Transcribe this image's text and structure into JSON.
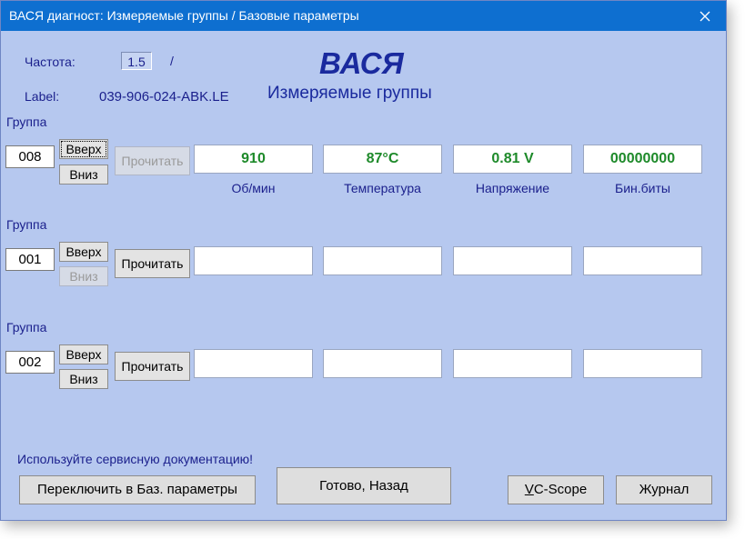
{
  "window": {
    "title": "ВАСЯ диагност: Измеряемые группы / Базовые параметры"
  },
  "header": {
    "freq_label": "Частота:",
    "freq_value": "1.5",
    "freq_suffix": "/",
    "label_label": "Label:",
    "label_value": "039-906-024-ABK.LE",
    "brand": "ВАСЯ",
    "subtitle": "Измеряемые группы"
  },
  "groups": [
    {
      "label": "Группа",
      "number": "008",
      "up": "Вверх",
      "down": "Вниз",
      "read": "Прочитать",
      "fields": [
        "910",
        "87°C",
        "0.81 V",
        "00000000"
      ],
      "units": [
        "Об/мин",
        "Температура",
        "Напряжение",
        "Бин.биты"
      ]
    },
    {
      "label": "Группа",
      "number": "001",
      "up": "Вверх",
      "down": "Вниз",
      "read": "Прочитать",
      "fields": [
        "",
        "",
        "",
        ""
      ]
    },
    {
      "label": "Группа",
      "number": "002",
      "up": "Вверх",
      "down": "Вниз",
      "read": "Прочитать",
      "fields": [
        "",
        "",
        "",
        ""
      ]
    }
  ],
  "footer": {
    "hint": "Используйте сервисную документацию!",
    "switch_button": "Переключить в Баз. параметры",
    "done_button": "Готово, Назад",
    "vcscope_underlined": "V",
    "vcscope_rest": "C-Scope",
    "log_button": "Журнал"
  }
}
